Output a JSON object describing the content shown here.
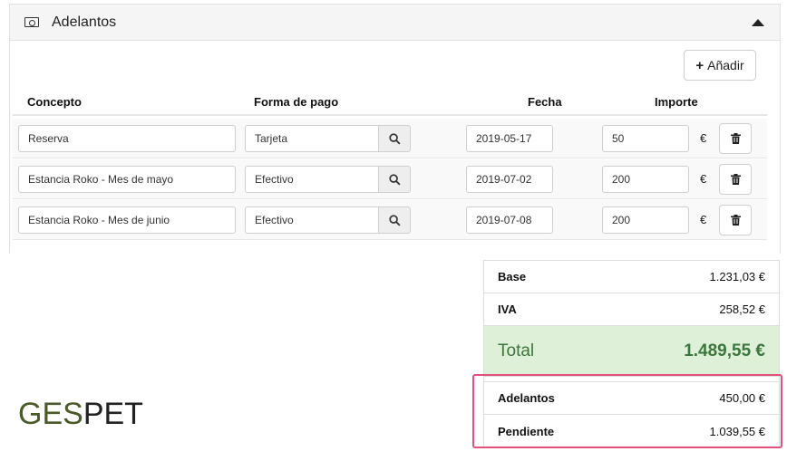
{
  "panel": {
    "title": "Adelantos",
    "add_label": "Añadir"
  },
  "columns": {
    "concepto": "Concepto",
    "forma": "Forma de pago",
    "fecha": "Fecha",
    "importe": "Importe"
  },
  "rows": [
    {
      "concepto": "Reserva",
      "forma": "Tarjeta",
      "fecha": "2019-05-17",
      "importe": "50",
      "currency": "€"
    },
    {
      "concepto": "Estancia Roko - Mes de mayo",
      "forma": "Efectivo",
      "fecha": "2019-07-02",
      "importe": "200",
      "currency": "€"
    },
    {
      "concepto": "Estancia Roko - Mes de junio",
      "forma": "Efectivo",
      "fecha": "2019-07-08",
      "importe": "200",
      "currency": "€"
    }
  ],
  "totals": {
    "base_label": "Base",
    "base_value": "1.231,03 €",
    "iva_label": "IVA",
    "iva_value": "258,52 €",
    "total_label": "Total",
    "total_value": "1.489,55 €",
    "adelantos_label": "Adelantos",
    "adelantos_value": "450,00 €",
    "pendiente_label": "Pendiente",
    "pendiente_value": "1.039,55 €"
  },
  "logo": {
    "part1": "GES",
    "part2": "PET"
  },
  "colors": {
    "total_bg": "#dff0d8",
    "total_text": "#3c763d",
    "highlight": "#e0527a",
    "logo_green": "#4a5a2a"
  },
  "icons": {
    "header": "money-icon",
    "collapse": "chevron-up-icon",
    "add": "plus-icon",
    "search": "search-icon",
    "delete": "trash-icon"
  }
}
